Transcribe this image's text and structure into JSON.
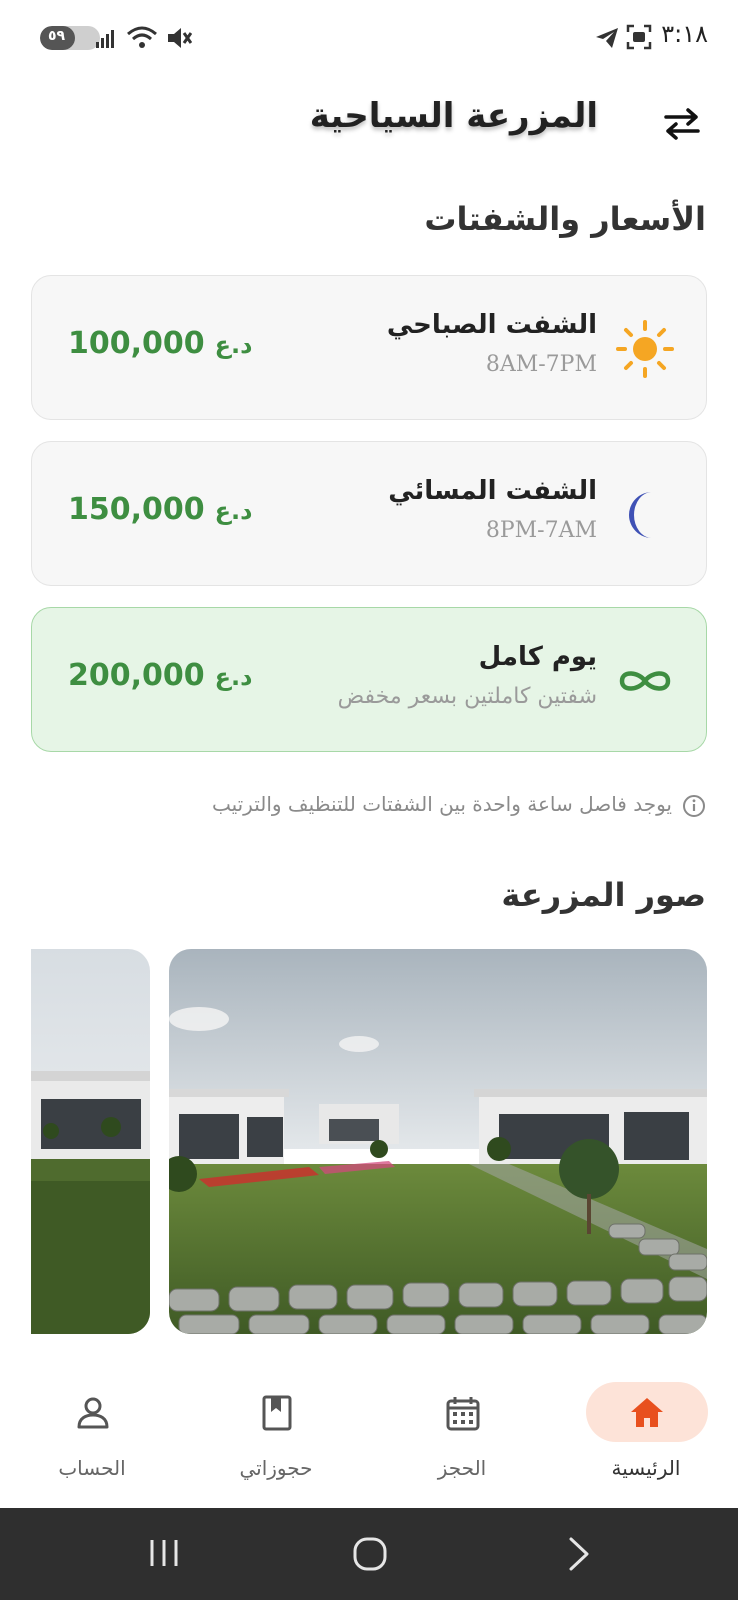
{
  "status_bar": {
    "time": "٣:١٨",
    "battery_text": "٥٩",
    "battery_level": 0.59
  },
  "header": {
    "title": "المزرعة السياحية",
    "swap_icon": "swap-arrows-icon"
  },
  "prices_section": {
    "title": "الأسعار والشفتات",
    "cards": [
      {
        "title": "الشفت الصباحي",
        "subtitle": "8AM-7PM",
        "price": "100,000",
        "currency": "د.ع",
        "icon": "sun-icon",
        "icon_color": "#f5a623",
        "selected": false
      },
      {
        "title": "الشفت المسائي",
        "subtitle": "8PM-7AM",
        "price": "150,000",
        "currency": "د.ع",
        "icon": "moon-icon",
        "icon_color": "#3f51b5",
        "selected": false
      },
      {
        "title": "يوم كامل",
        "subtitle": "شفتين كاملتين بسعر مخفض",
        "price": "200,000",
        "currency": "د.ع",
        "icon": "infinity-icon",
        "icon_color": "#3e8e41",
        "selected": true
      }
    ],
    "info_note": "يوجد فاصل ساعة واحدة بين الشفتات للتنظيف والترتيب"
  },
  "photos_section": {
    "title": "صور المزرعة"
  },
  "bottom_nav": {
    "items": [
      {
        "label": "الرئيسية",
        "icon": "home-icon",
        "active": true
      },
      {
        "label": "الحجز",
        "icon": "calendar-icon",
        "active": false
      },
      {
        "label": "حجوزاتي",
        "icon": "bookmark-icon",
        "active": false
      },
      {
        "label": "الحساب",
        "icon": "person-icon",
        "active": false
      }
    ]
  },
  "colors": {
    "accent": "#e8501e",
    "price_green": "#3e8e41",
    "selected_card_bg": "#e6f5e6"
  }
}
